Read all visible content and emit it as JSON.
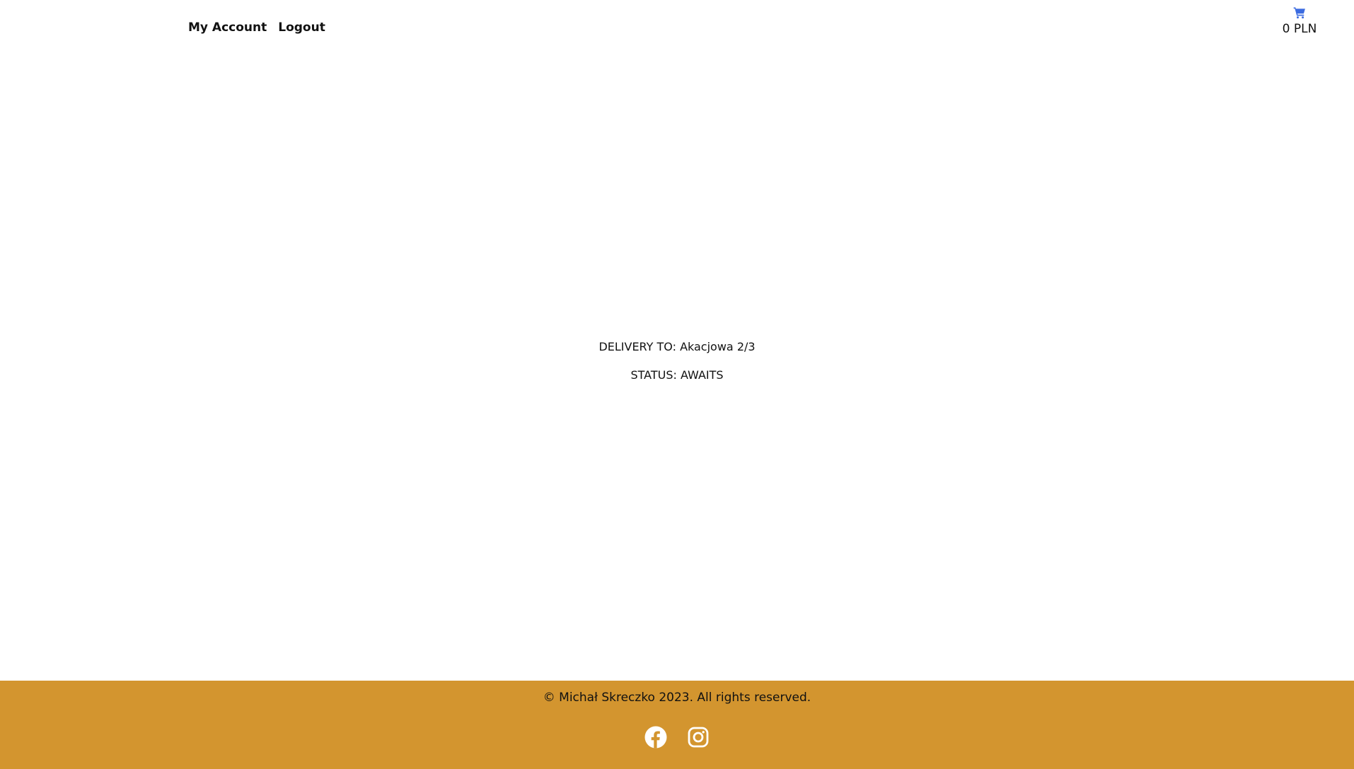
{
  "header": {
    "nav": {
      "my_account": "My Account",
      "logout": "Logout"
    },
    "cart": {
      "icon": "shopping-cart-icon",
      "total": "0 PLN",
      "icon_color": "#3b6be0"
    }
  },
  "order": {
    "delivery": "DELIVERY TO: Akacjowa 2/3",
    "status": "STATUS: AWAITS"
  },
  "footer": {
    "copyright": "© Michał Skreczko 2023. All rights reserved.",
    "background_color": "#d3952f",
    "social": [
      {
        "icon": "facebook-icon"
      },
      {
        "icon": "instagram-icon"
      }
    ]
  }
}
